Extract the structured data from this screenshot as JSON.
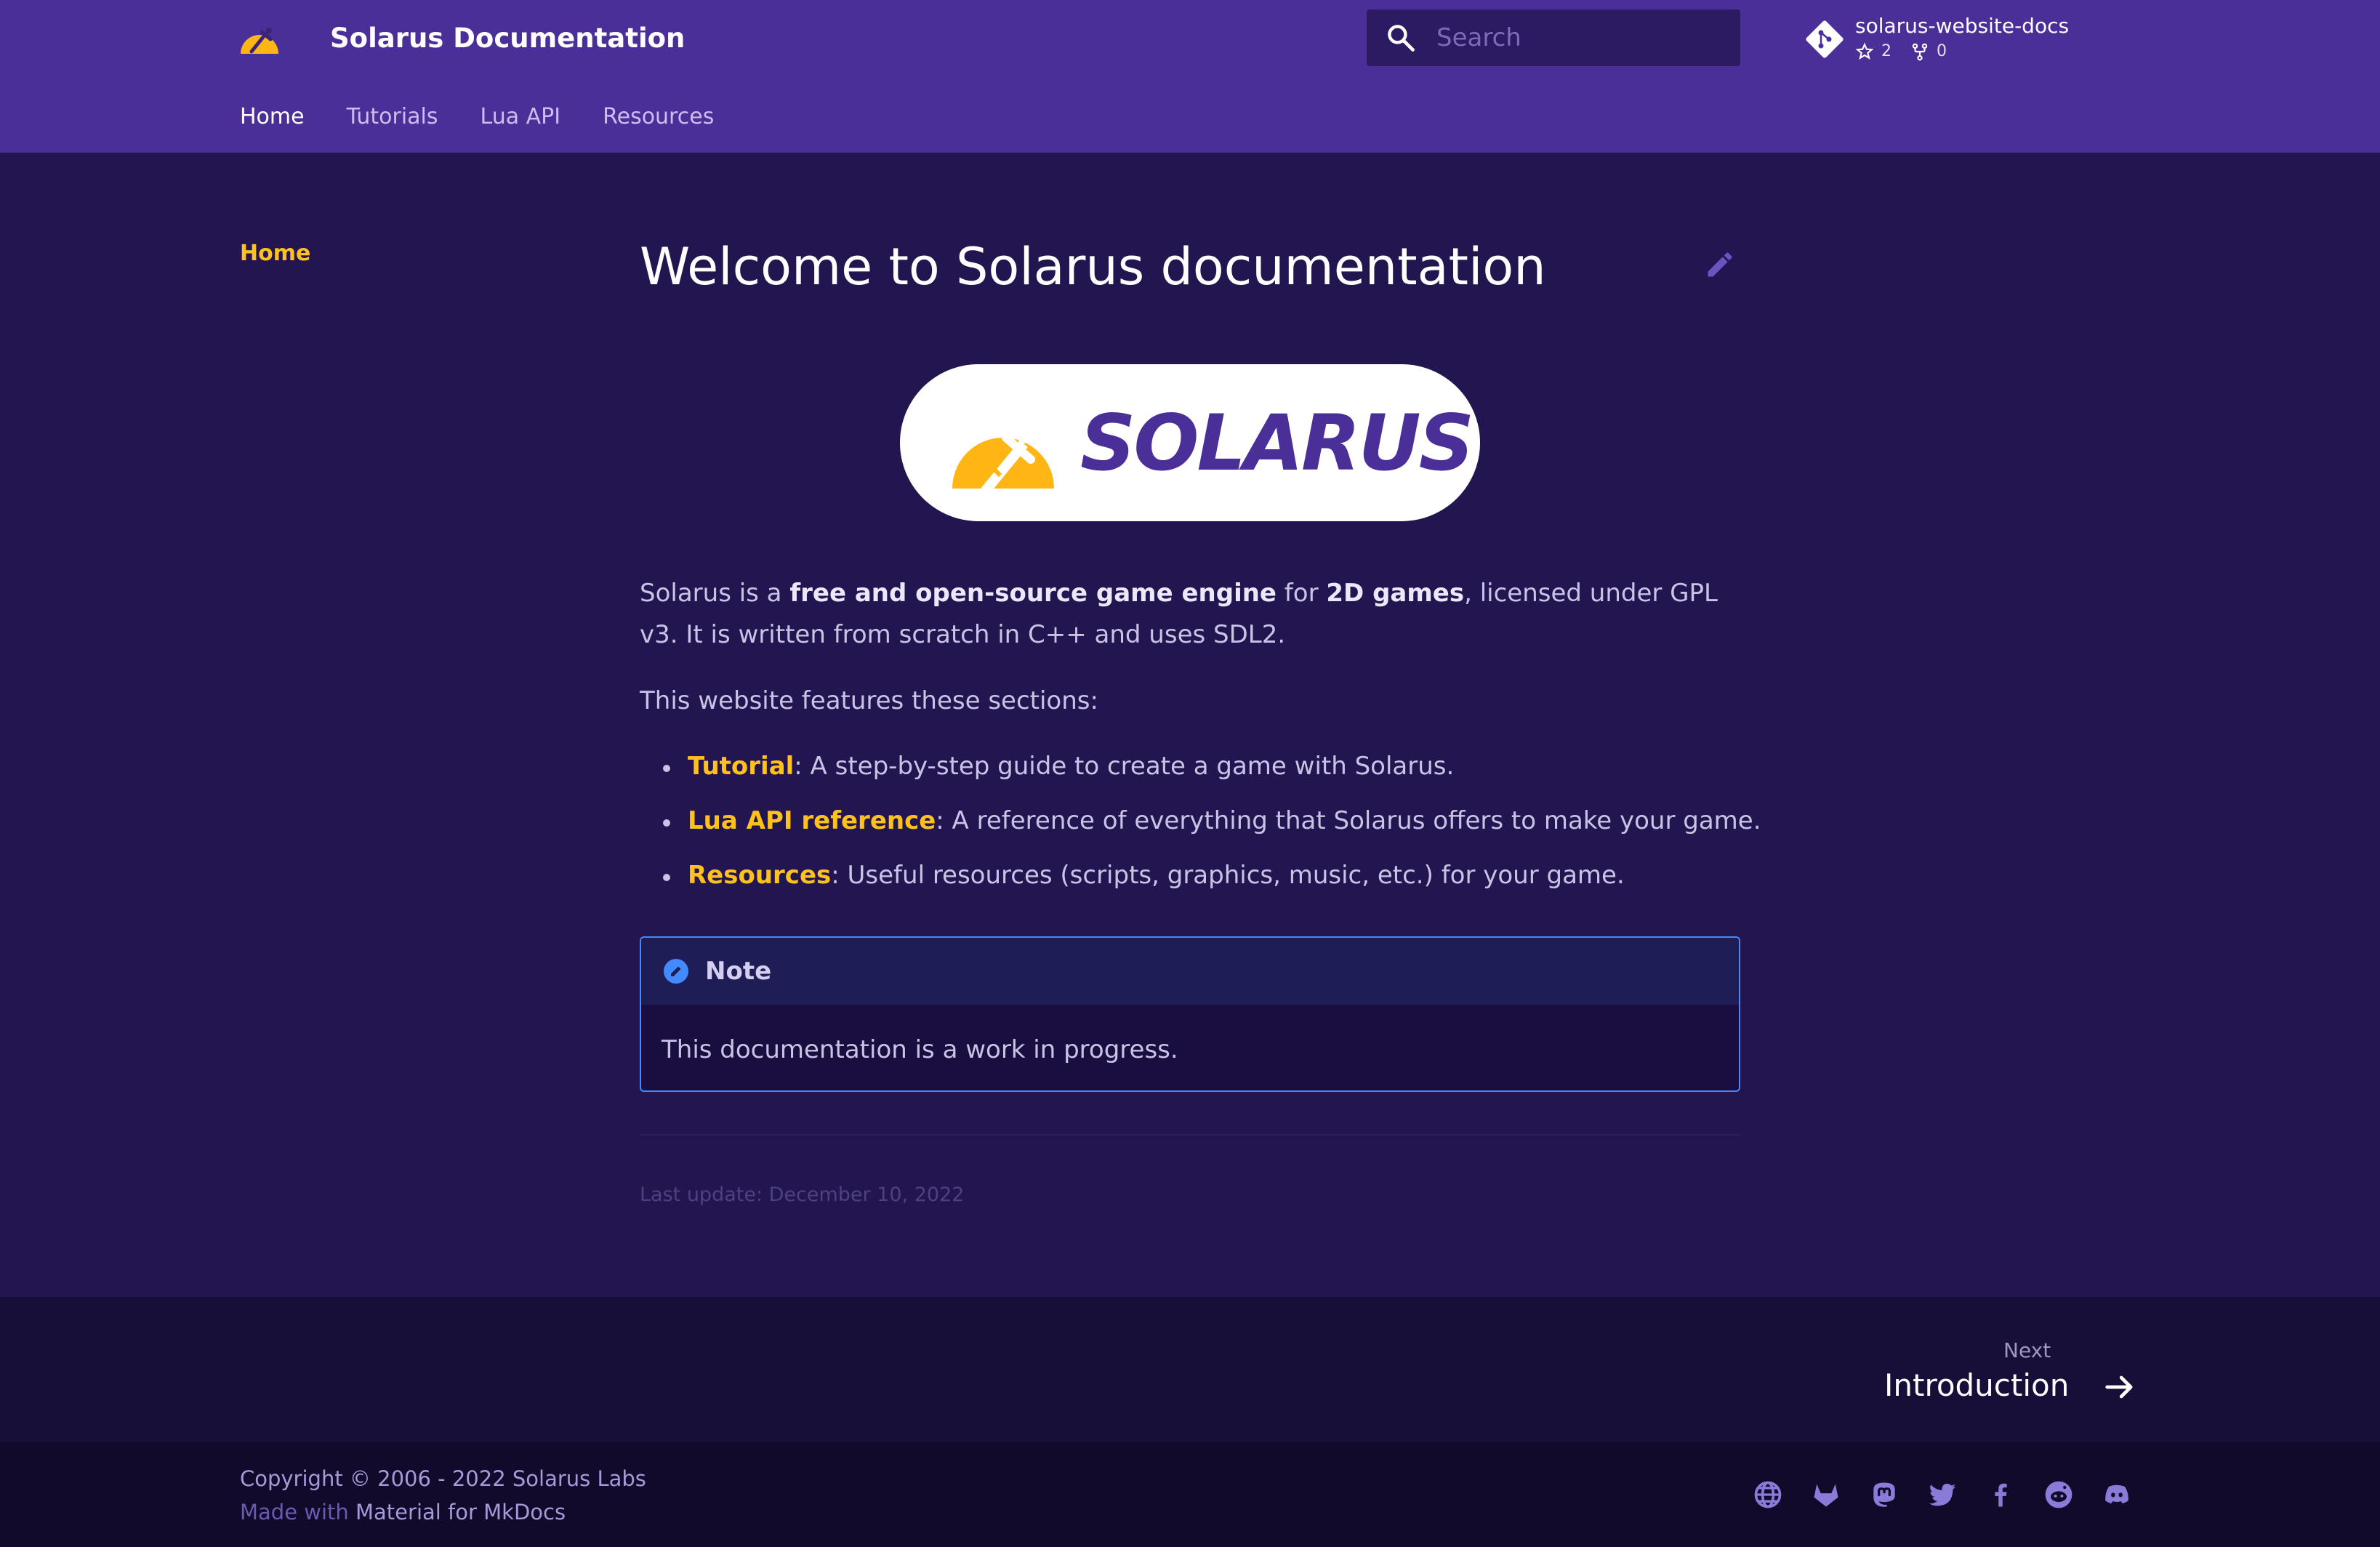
{
  "header": {
    "title": "Solarus Documentation",
    "search_placeholder": "Search",
    "repo": {
      "name": "solarus-website-docs",
      "stars": "2",
      "forks": "0"
    },
    "tabs": [
      {
        "label": "Home",
        "active": true
      },
      {
        "label": "Tutorials",
        "active": false
      },
      {
        "label": "Lua API",
        "active": false
      },
      {
        "label": "Resources",
        "active": false
      }
    ]
  },
  "sidebar": {
    "items": [
      {
        "label": "Home",
        "active": true
      }
    ]
  },
  "content": {
    "title": "Welcome to Solarus documentation",
    "hero_wordmark": "SOLARUS",
    "intro": {
      "t1": "Solarus is a ",
      "b1": "free and open-source game engine",
      "t2": " for ",
      "b2": "2D games",
      "t3": ", licensed under GPL v3. It is written from scratch in C++ and uses SDL2."
    },
    "sections_intro": "This website features these sections:",
    "sections": [
      {
        "link": "Tutorial",
        "text": ": A step-by-step guide to create a game with Solarus."
      },
      {
        "link": "Lua API reference",
        "text": ": A reference of everything that Solarus offers to make your game."
      },
      {
        "link": "Resources",
        "text": ": Useful resources (scripts, graphics, music, etc.) for your game."
      }
    ],
    "note": {
      "title": "Note",
      "body": "This documentation is a work in progress."
    },
    "last_update": "Last update: December 10, 2022"
  },
  "footer": {
    "next_label": "Next",
    "next_title": "Introduction",
    "copyright": "Copyright © 2006 - 2022 Solarus Labs",
    "made_with_prefix": "Made with ",
    "made_with_link": "Material for MkDocs",
    "socials": [
      "globe-icon",
      "gitlab-icon",
      "mastodon-icon",
      "twitter-icon",
      "facebook-icon",
      "reddit-icon",
      "discord-icon"
    ]
  },
  "colors": {
    "header_bg": "#4b2f99",
    "page_bg": "#231650",
    "accent": "#ffc21c",
    "note_border": "#448aff"
  }
}
